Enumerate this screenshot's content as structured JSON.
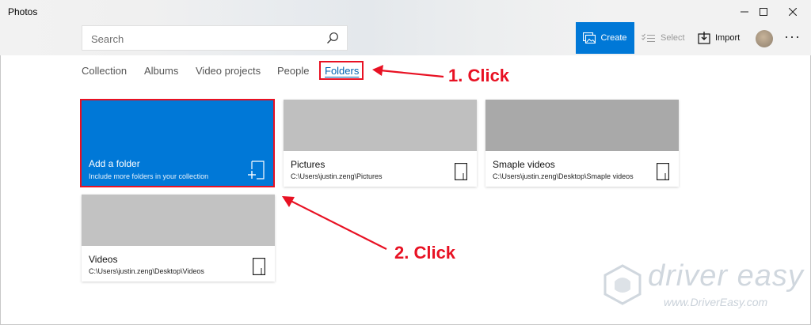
{
  "window": {
    "title": "Photos"
  },
  "search": {
    "placeholder": "Search"
  },
  "toolbar": {
    "create_label": "Create",
    "select_label": "Select",
    "import_label": "Import"
  },
  "nav": {
    "items": [
      {
        "label": "Collection"
      },
      {
        "label": "Albums"
      },
      {
        "label": "Video projects"
      },
      {
        "label": "People"
      },
      {
        "label": "Folders",
        "active": true
      }
    ]
  },
  "add_folder": {
    "title": "Add a folder",
    "subtitle": "Include more folders in your collection"
  },
  "folders": [
    {
      "name": "Pictures",
      "path": "C:\\Users\\justin.zeng\\Pictures"
    },
    {
      "name": "Smaple videos",
      "path": "C:\\Users\\justin.zeng\\Desktop\\Smaple videos"
    },
    {
      "name": "Videos",
      "path": "C:\\Users\\justin.zeng\\Desktop\\Videos"
    }
  ],
  "annotations": {
    "step1": "1. Click",
    "step2": "2. Click"
  },
  "watermark": {
    "brand": "driver easy",
    "url": "www.DriverEasy.com"
  },
  "colors": {
    "accent": "#0078d7",
    "highlight": "#e81123"
  }
}
